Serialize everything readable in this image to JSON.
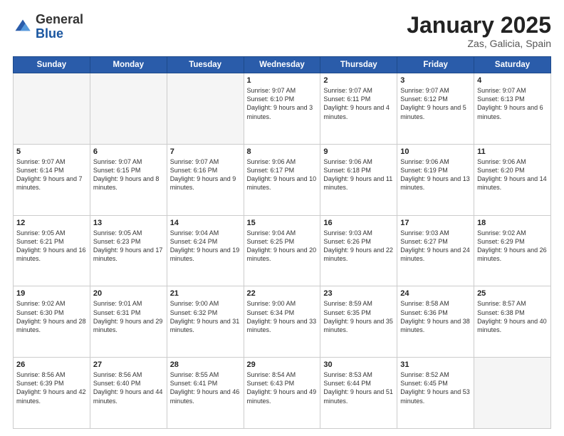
{
  "logo": {
    "general": "General",
    "blue": "Blue"
  },
  "header": {
    "month": "January 2025",
    "location": "Zas, Galicia, Spain"
  },
  "weekdays": [
    "Sunday",
    "Monday",
    "Tuesday",
    "Wednesday",
    "Thursday",
    "Friday",
    "Saturday"
  ],
  "weeks": [
    [
      {
        "day": "",
        "sunrise": "",
        "sunset": "",
        "daylight": ""
      },
      {
        "day": "",
        "sunrise": "",
        "sunset": "",
        "daylight": ""
      },
      {
        "day": "",
        "sunrise": "",
        "sunset": "",
        "daylight": ""
      },
      {
        "day": "1",
        "sunrise": "Sunrise: 9:07 AM",
        "sunset": "Sunset: 6:10 PM",
        "daylight": "Daylight: 9 hours and 3 minutes."
      },
      {
        "day": "2",
        "sunrise": "Sunrise: 9:07 AM",
        "sunset": "Sunset: 6:11 PM",
        "daylight": "Daylight: 9 hours and 4 minutes."
      },
      {
        "day": "3",
        "sunrise": "Sunrise: 9:07 AM",
        "sunset": "Sunset: 6:12 PM",
        "daylight": "Daylight: 9 hours and 5 minutes."
      },
      {
        "day": "4",
        "sunrise": "Sunrise: 9:07 AM",
        "sunset": "Sunset: 6:13 PM",
        "daylight": "Daylight: 9 hours and 6 minutes."
      }
    ],
    [
      {
        "day": "5",
        "sunrise": "Sunrise: 9:07 AM",
        "sunset": "Sunset: 6:14 PM",
        "daylight": "Daylight: 9 hours and 7 minutes."
      },
      {
        "day": "6",
        "sunrise": "Sunrise: 9:07 AM",
        "sunset": "Sunset: 6:15 PM",
        "daylight": "Daylight: 9 hours and 8 minutes."
      },
      {
        "day": "7",
        "sunrise": "Sunrise: 9:07 AM",
        "sunset": "Sunset: 6:16 PM",
        "daylight": "Daylight: 9 hours and 9 minutes."
      },
      {
        "day": "8",
        "sunrise": "Sunrise: 9:06 AM",
        "sunset": "Sunset: 6:17 PM",
        "daylight": "Daylight: 9 hours and 10 minutes."
      },
      {
        "day": "9",
        "sunrise": "Sunrise: 9:06 AM",
        "sunset": "Sunset: 6:18 PM",
        "daylight": "Daylight: 9 hours and 11 minutes."
      },
      {
        "day": "10",
        "sunrise": "Sunrise: 9:06 AM",
        "sunset": "Sunset: 6:19 PM",
        "daylight": "Daylight: 9 hours and 13 minutes."
      },
      {
        "day": "11",
        "sunrise": "Sunrise: 9:06 AM",
        "sunset": "Sunset: 6:20 PM",
        "daylight": "Daylight: 9 hours and 14 minutes."
      }
    ],
    [
      {
        "day": "12",
        "sunrise": "Sunrise: 9:05 AM",
        "sunset": "Sunset: 6:21 PM",
        "daylight": "Daylight: 9 hours and 16 minutes."
      },
      {
        "day": "13",
        "sunrise": "Sunrise: 9:05 AM",
        "sunset": "Sunset: 6:23 PM",
        "daylight": "Daylight: 9 hours and 17 minutes."
      },
      {
        "day": "14",
        "sunrise": "Sunrise: 9:04 AM",
        "sunset": "Sunset: 6:24 PM",
        "daylight": "Daylight: 9 hours and 19 minutes."
      },
      {
        "day": "15",
        "sunrise": "Sunrise: 9:04 AM",
        "sunset": "Sunset: 6:25 PM",
        "daylight": "Daylight: 9 hours and 20 minutes."
      },
      {
        "day": "16",
        "sunrise": "Sunrise: 9:03 AM",
        "sunset": "Sunset: 6:26 PM",
        "daylight": "Daylight: 9 hours and 22 minutes."
      },
      {
        "day": "17",
        "sunrise": "Sunrise: 9:03 AM",
        "sunset": "Sunset: 6:27 PM",
        "daylight": "Daylight: 9 hours and 24 minutes."
      },
      {
        "day": "18",
        "sunrise": "Sunrise: 9:02 AM",
        "sunset": "Sunset: 6:29 PM",
        "daylight": "Daylight: 9 hours and 26 minutes."
      }
    ],
    [
      {
        "day": "19",
        "sunrise": "Sunrise: 9:02 AM",
        "sunset": "Sunset: 6:30 PM",
        "daylight": "Daylight: 9 hours and 28 minutes."
      },
      {
        "day": "20",
        "sunrise": "Sunrise: 9:01 AM",
        "sunset": "Sunset: 6:31 PM",
        "daylight": "Daylight: 9 hours and 29 minutes."
      },
      {
        "day": "21",
        "sunrise": "Sunrise: 9:00 AM",
        "sunset": "Sunset: 6:32 PM",
        "daylight": "Daylight: 9 hours and 31 minutes."
      },
      {
        "day": "22",
        "sunrise": "Sunrise: 9:00 AM",
        "sunset": "Sunset: 6:34 PM",
        "daylight": "Daylight: 9 hours and 33 minutes."
      },
      {
        "day": "23",
        "sunrise": "Sunrise: 8:59 AM",
        "sunset": "Sunset: 6:35 PM",
        "daylight": "Daylight: 9 hours and 35 minutes."
      },
      {
        "day": "24",
        "sunrise": "Sunrise: 8:58 AM",
        "sunset": "Sunset: 6:36 PM",
        "daylight": "Daylight: 9 hours and 38 minutes."
      },
      {
        "day": "25",
        "sunrise": "Sunrise: 8:57 AM",
        "sunset": "Sunset: 6:38 PM",
        "daylight": "Daylight: 9 hours and 40 minutes."
      }
    ],
    [
      {
        "day": "26",
        "sunrise": "Sunrise: 8:56 AM",
        "sunset": "Sunset: 6:39 PM",
        "daylight": "Daylight: 9 hours and 42 minutes."
      },
      {
        "day": "27",
        "sunrise": "Sunrise: 8:56 AM",
        "sunset": "Sunset: 6:40 PM",
        "daylight": "Daylight: 9 hours and 44 minutes."
      },
      {
        "day": "28",
        "sunrise": "Sunrise: 8:55 AM",
        "sunset": "Sunset: 6:41 PM",
        "daylight": "Daylight: 9 hours and 46 minutes."
      },
      {
        "day": "29",
        "sunrise": "Sunrise: 8:54 AM",
        "sunset": "Sunset: 6:43 PM",
        "daylight": "Daylight: 9 hours and 49 minutes."
      },
      {
        "day": "30",
        "sunrise": "Sunrise: 8:53 AM",
        "sunset": "Sunset: 6:44 PM",
        "daylight": "Daylight: 9 hours and 51 minutes."
      },
      {
        "day": "31",
        "sunrise": "Sunrise: 8:52 AM",
        "sunset": "Sunset: 6:45 PM",
        "daylight": "Daylight: 9 hours and 53 minutes."
      },
      {
        "day": "",
        "sunrise": "",
        "sunset": "",
        "daylight": ""
      }
    ]
  ]
}
